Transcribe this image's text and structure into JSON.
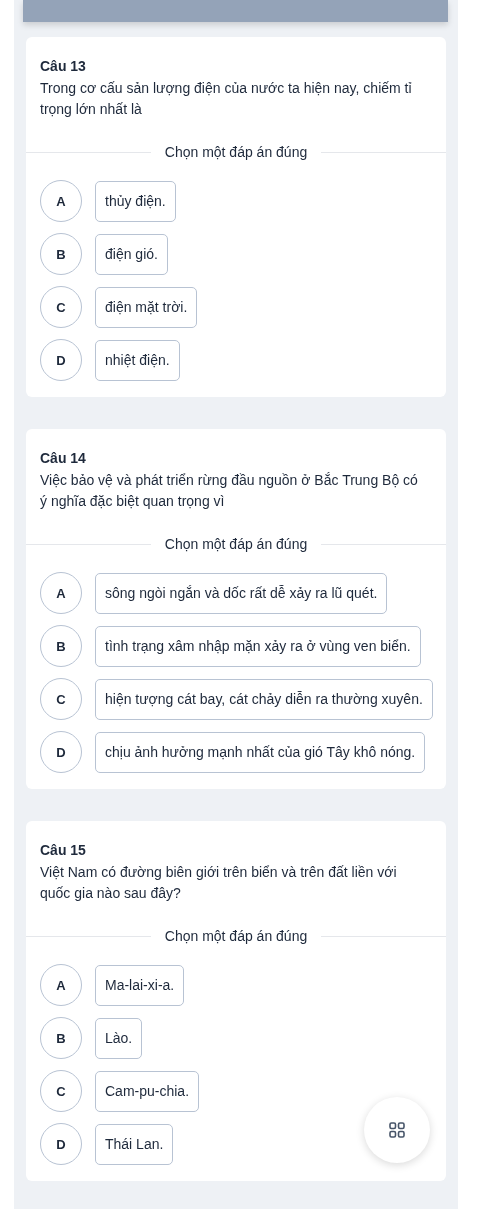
{
  "questions": [
    {
      "title": "Câu 13",
      "text": "Trong cơ cấu sản lượng điện của nước ta hiện nay, chiếm tỉ trọng lớn nhất là",
      "instruction": "Chọn một đáp án đúng",
      "options": [
        {
          "letter": "A",
          "text": "thủy điện."
        },
        {
          "letter": "B",
          "text": "điện gió."
        },
        {
          "letter": "C",
          "text": "điện mặt trời."
        },
        {
          "letter": "D",
          "text": "nhiệt điện."
        }
      ]
    },
    {
      "title": "Câu 14",
      "text": "Việc bảo vệ và phát triển rừng đầu nguồn ở Bắc Trung Bộ có ý nghĩa đặc biệt quan trọng vì",
      "instruction": "Chọn một đáp án đúng",
      "options": [
        {
          "letter": "A",
          "text": "sông ngòi ngắn và dốc rất dễ xảy ra lũ quét."
        },
        {
          "letter": "B",
          "text": "tình trạng xâm nhập mặn xảy ra ở vùng ven biển."
        },
        {
          "letter": "C",
          "text": "hiện tượng cát bay, cát chảy diễn ra thường xuyên."
        },
        {
          "letter": "D",
          "text": "chịu ảnh hưởng mạnh nhất của gió Tây khô nóng."
        }
      ]
    },
    {
      "title": "Câu 15",
      "text": "Việt Nam có đường biên giới trên biển và trên đất liền với quốc gia nào sau đây?",
      "instruction": "Chọn một đáp án đúng",
      "options": [
        {
          "letter": "A",
          "text": "Ma-lai-xi-a."
        },
        {
          "letter": "B",
          "text": "Lào."
        },
        {
          "letter": "C",
          "text": "Cam-pu-chia."
        },
        {
          "letter": "D",
          "text": "Thái Lan."
        }
      ]
    }
  ]
}
